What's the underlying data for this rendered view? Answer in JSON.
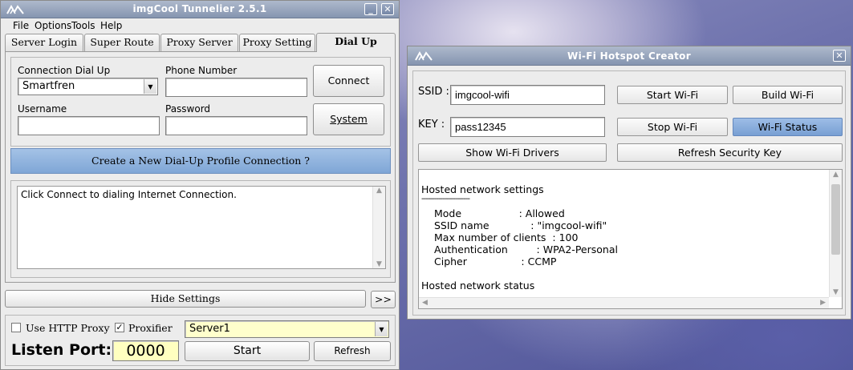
{
  "main_window": {
    "title": "imgCool Tunnelier 2.5.1",
    "minimize_glyph": "_",
    "close_glyph": "✕",
    "menu": [
      "File",
      "Options",
      "Tools",
      "Help"
    ],
    "tabs": [
      "Server Login",
      "Super Route",
      "Proxy Server",
      "Proxy Setting",
      "Dial Up"
    ],
    "active_tab": "Dial Up",
    "dialup": {
      "connection_label": "Connection Dial Up",
      "connection_value": "Smartfren",
      "phone_label": "Phone Number",
      "phone_value": "",
      "username_label": "Username",
      "username_value": "",
      "password_label": "Password",
      "password_value": "",
      "connect_button": "Connect",
      "system_button": "System",
      "create_profile_button": "Create a New Dial-Up Profile Connection ?",
      "log_text": "Click Connect to dialing Internet Connection."
    },
    "hide_settings_button": "Hide Settings",
    "expand_button": ">>",
    "bottom": {
      "use_http_proxy_label": "Use HTTP Proxy",
      "use_http_proxy_checked": false,
      "proxifier_label": "Proxifier",
      "proxifier_checked": true,
      "server_value": "Server1",
      "listen_port_label": "Listen Port:",
      "listen_port_value": "0000",
      "start_button": "Start",
      "refresh_button": "Refresh"
    }
  },
  "wifi_window": {
    "title": "Wi-Fi Hotspot Creator",
    "close_glyph": "✕",
    "ssid_label": "SSID :",
    "ssid_value": "imgcool-wifi",
    "key_label": "KEY :",
    "key_value": "pass12345",
    "start_button": "Start Wi-Fi",
    "build_button": "Build Wi-Fi",
    "stop_button": "Stop Wi-Fi",
    "status_button": "Wi-Fi Status",
    "drivers_button": "Show Wi-Fi Drivers",
    "refresh_key_button": "Refresh  Security Key",
    "output": {
      "heading": "Hosted network settings",
      "rule": "-----------------------",
      "rows": [
        "Mode                  : Allowed",
        "SSID name             : \"imgcool-wifi\"",
        "Max number of clients  : 100",
        "Authentication         : WPA2-Personal",
        "Cipher                 : CCMP"
      ],
      "status_heading": "Hosted network status"
    }
  },
  "colors": {
    "titlebar": "#8595b0",
    "accent_button": "#789fd3",
    "port_field": "#ffffc0",
    "server_field": "#ffffcc"
  }
}
